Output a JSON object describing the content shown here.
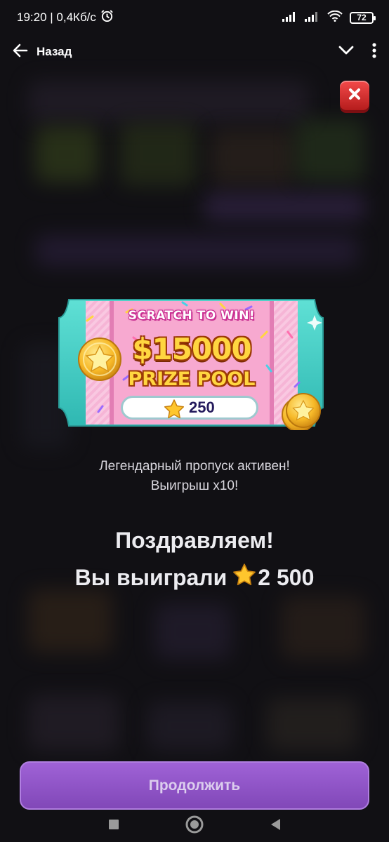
{
  "status_bar": {
    "time_and_speed": "19:20 | 0,4Кб/с",
    "battery": "72"
  },
  "nav": {
    "back_label": "Назад"
  },
  "ticket": {
    "headline": "SCRATCH TO WIN!",
    "amount": "$15000",
    "subtitle": "PRIZE POOL",
    "price": "250",
    "icon": "star-icon"
  },
  "messages": {
    "legend_line1": "Легендарный пропуск активен!",
    "legend_line2": "Выигрыш x10!",
    "congrats": "Поздравляем!",
    "win_prefix": "Вы выиграли",
    "win_amount": "2 500"
  },
  "buttons": {
    "continue_label": "Продолжить"
  },
  "colors": {
    "background": "#111014",
    "accent_purple": "#8f55c8",
    "ticket_teal": "#3cc9c0",
    "ticket_pink": "#f3a8cf",
    "gold": "#ffd640",
    "close_red": "#d92b2b"
  }
}
